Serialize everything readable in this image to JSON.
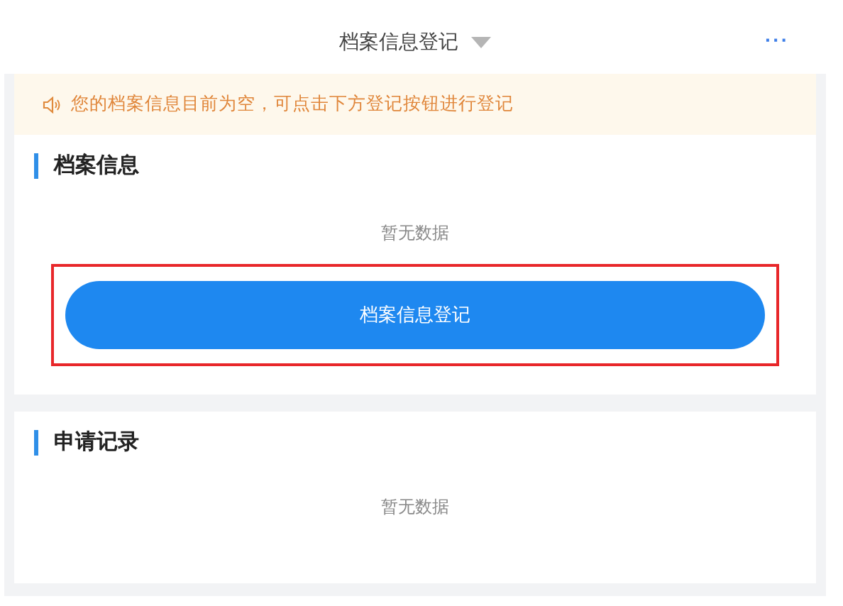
{
  "header": {
    "title": "档案信息登记",
    "more": "···"
  },
  "notice": {
    "text": "您的档案信息目前为空，可点击下方登记按钮进行登记"
  },
  "sections": [
    {
      "title": "档案信息",
      "empty_text": "暂无数据",
      "button": {
        "label": "档案信息登记",
        "highlighted": true
      }
    },
    {
      "title": "申请记录",
      "empty_text": "暂无数据"
    }
  ]
}
